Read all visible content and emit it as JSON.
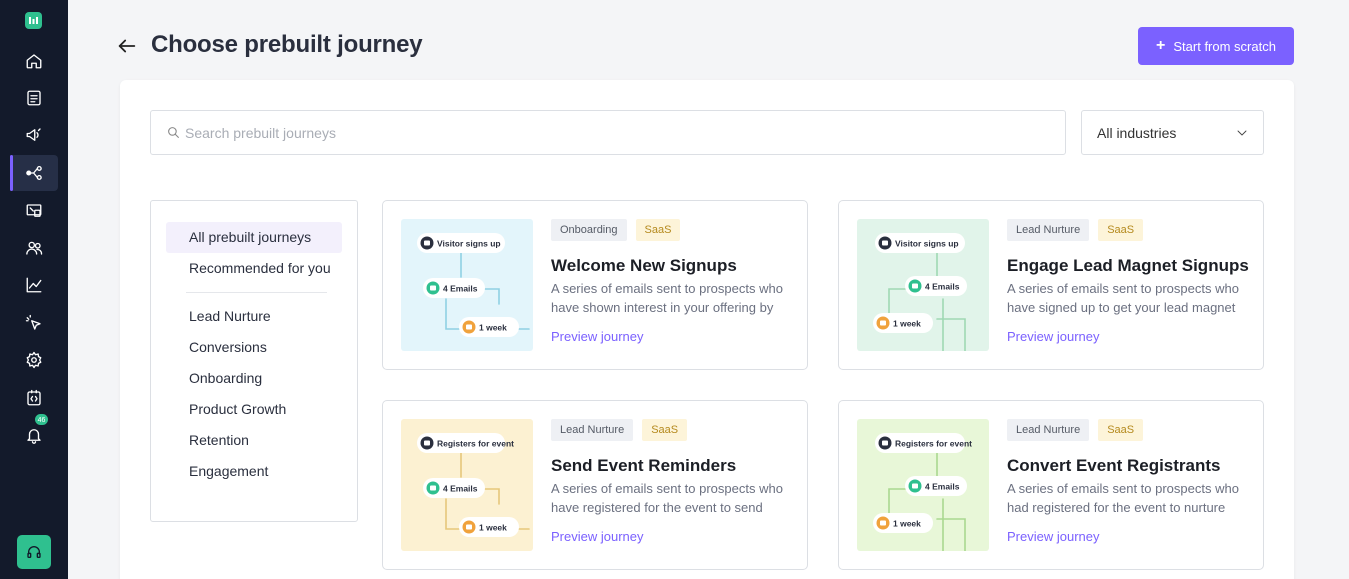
{
  "header": {
    "title": "Choose prebuilt journey",
    "start_button": "Start from scratch"
  },
  "sidebar": {
    "items": [
      {
        "name": "home-icon"
      },
      {
        "name": "document-icon"
      },
      {
        "name": "megaphone-icon"
      },
      {
        "name": "journey-icon",
        "active": true
      },
      {
        "name": "screen-icon"
      },
      {
        "name": "users-icon"
      },
      {
        "name": "chart-icon"
      },
      {
        "name": "cursor-icon"
      },
      {
        "name": "gear-icon"
      },
      {
        "name": "code-icon"
      },
      {
        "name": "bell-icon"
      }
    ],
    "notification_count": "46",
    "support": "headset-icon"
  },
  "filters": {
    "search_placeholder": "Search prebuilt journeys",
    "industry_selected": "All industries"
  },
  "categories": {
    "top": [
      "All prebuilt journeys",
      "Recommended for you"
    ],
    "list": [
      "Lead Nurture",
      "Conversions",
      "Onboarding",
      "Product Growth",
      "Retention",
      "Engagement"
    ],
    "active": "All prebuilt journeys"
  },
  "cards": [
    {
      "category": "Onboarding",
      "industry": "SaaS",
      "title": "Welcome New Signups",
      "description": "A series of emails sent to prospects who have shown interest in your offering by",
      "link": "Preview journey",
      "thumb": {
        "trigger": "Visitor signs up",
        "emails": "4 Emails",
        "wait": "1 week",
        "bg": "#e3f5fb"
      }
    },
    {
      "category": "Lead Nurture",
      "industry": "SaaS",
      "title": "Engage Lead Magnet Signups",
      "description": "A series of emails sent to prospects who have signed up to get your lead magnet",
      "link": "Preview journey",
      "thumb": {
        "trigger": "Visitor signs up",
        "emails": "4 Emails",
        "wait": "1 week",
        "bg": "#e1f4ea"
      }
    },
    {
      "category": "Lead Nurture",
      "industry": "SaaS",
      "title": "Send Event Reminders",
      "description": "A series of emails sent to prospects who have registered for the event to send",
      "link": "Preview journey",
      "thumb": {
        "trigger": "Registers for event",
        "emails": "4 Emails",
        "wait": "1 week",
        "bg": "#fcf1d2"
      }
    },
    {
      "category": "Lead Nurture",
      "industry": "SaaS",
      "title": "Convert Event Registrants",
      "description": "A series of emails sent to prospects who had registered for the event to nurture",
      "link": "Preview journey",
      "thumb": {
        "trigger": "Registers for event",
        "emails": "4 Emails",
        "wait": "1 week",
        "bg": "#e8f7d8"
      }
    }
  ],
  "colors": {
    "accent": "#7b61ff",
    "sidebar": "#131a2b",
    "green": "#2fc08f"
  }
}
